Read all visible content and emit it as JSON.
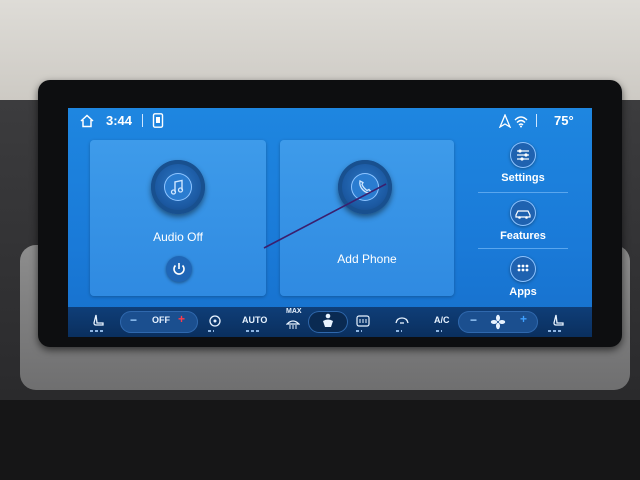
{
  "status_bar": {
    "time": "3:44",
    "temperature": "75°",
    "icons": [
      "home-icon",
      "phone-icon",
      "navigation-icon",
      "wifi-icon"
    ]
  },
  "audio_card": {
    "label": "Audio Off",
    "icons": [
      "music-note-icon",
      "power-icon"
    ]
  },
  "phone_card": {
    "label": "Add Phone",
    "icons": [
      "phone-handset-icon"
    ]
  },
  "side_menu": {
    "items": [
      {
        "label": "Settings",
        "icon": "settings-sliders-icon"
      },
      {
        "label": "Features",
        "icon": "car-icon"
      },
      {
        "label": "Apps",
        "icon": "apps-grid-icon"
      }
    ]
  },
  "climate_bar": {
    "driver_temp": "OFF",
    "auto_label": "AUTO",
    "max_label": "MAX",
    "ac_label": "A/C",
    "minus": "−",
    "plus": "+",
    "icons": [
      "seat-heat-icon",
      "fan-recirc-icon",
      "max-defrost-icon",
      "climate-person-icon",
      "rear-defrost-icon",
      "recirculation-icon",
      "fan-icon",
      "passenger-seat-icon"
    ]
  },
  "colors": {
    "screen": "#1a7ad8",
    "card": "#3593e6",
    "climate_bar": "#0d376b",
    "accent_red": "#ff3b4a",
    "accent_blue": "#3fa0ff"
  }
}
